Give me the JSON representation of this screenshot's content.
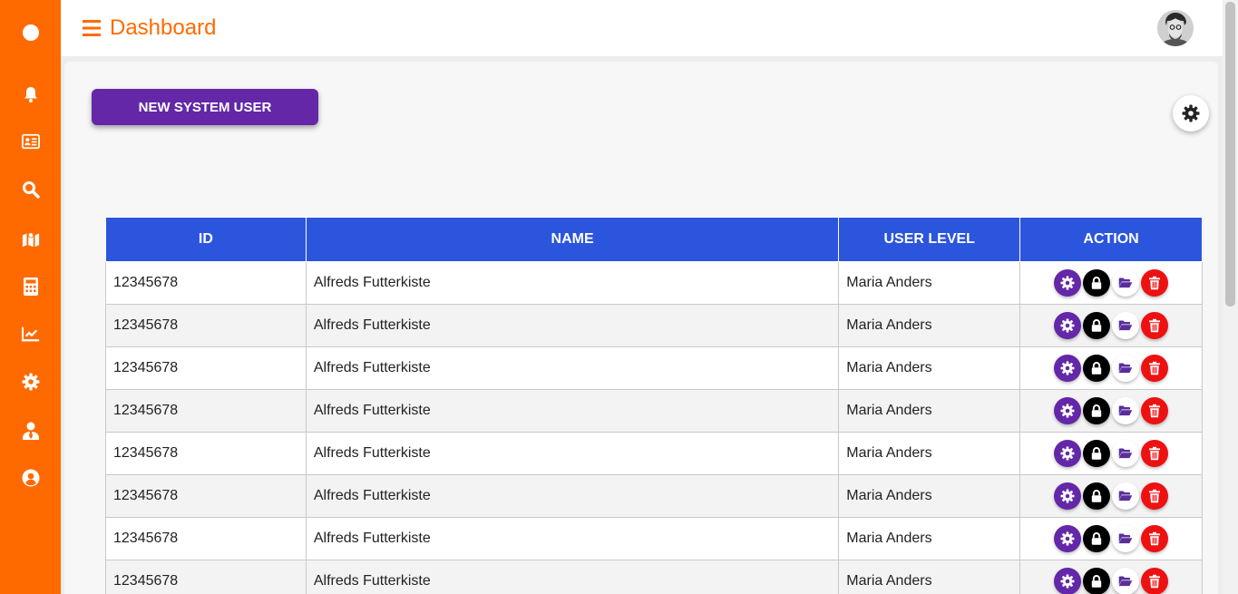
{
  "header": {
    "title": "Dashboard"
  },
  "toolbar": {
    "new_user_label": "NEW SYSTEM USER"
  },
  "sidebar": {
    "items": [
      {
        "icon": "circle-icon"
      },
      {
        "icon": "bell-icon"
      },
      {
        "icon": "id-card-icon"
      },
      {
        "icon": "search-icon"
      },
      {
        "icon": "map-icon"
      },
      {
        "icon": "calculator-icon"
      },
      {
        "icon": "chart-line-icon"
      },
      {
        "icon": "gear-icon"
      },
      {
        "icon": "user-tie-icon"
      },
      {
        "icon": "user-circle-icon"
      }
    ]
  },
  "table": {
    "columns": [
      "ID",
      "NAME",
      "USER LEVEL",
      "ACTION"
    ],
    "rows": [
      {
        "id": "12345678",
        "name": "Alfreds Futterkiste",
        "level": "Maria Anders"
      },
      {
        "id": "12345678",
        "name": "Alfreds Futterkiste",
        "level": "Maria Anders"
      },
      {
        "id": "12345678",
        "name": "Alfreds Futterkiste",
        "level": "Maria Anders"
      },
      {
        "id": "12345678",
        "name": "Alfreds Futterkiste",
        "level": "Maria Anders"
      },
      {
        "id": "12345678",
        "name": "Alfreds Futterkiste",
        "level": "Maria Anders"
      },
      {
        "id": "12345678",
        "name": "Alfreds Futterkiste",
        "level": "Maria Anders"
      },
      {
        "id": "12345678",
        "name": "Alfreds Futterkiste",
        "level": "Maria Anders"
      },
      {
        "id": "12345678",
        "name": "Alfreds Futterkiste",
        "level": "Maria Anders"
      }
    ],
    "actions": [
      {
        "icon": "gear-icon",
        "color": "#6327a8"
      },
      {
        "icon": "lock-icon",
        "color": "#000000"
      },
      {
        "icon": "folder-open-icon",
        "color": "#ffffff"
      },
      {
        "icon": "trash-icon",
        "color": "#ee1111"
      }
    ]
  },
  "colors": {
    "accent": "#ff6a00",
    "primary": "#6327a8",
    "table_header": "#2b55dd",
    "danger": "#ee1111"
  }
}
